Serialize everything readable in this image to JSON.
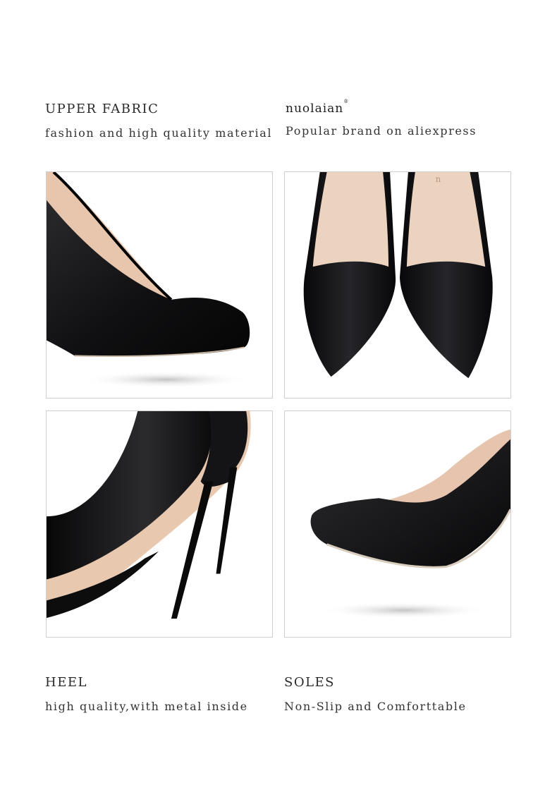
{
  "features": {
    "upper": {
      "title": "UPPER FABRIC",
      "subtitle": "fashion and high quality material"
    },
    "brand": {
      "logo": "nuolaian",
      "trademark": "®",
      "subtitle": "Popular brand on aliexpress"
    },
    "heel": {
      "title": "HEEL",
      "subtitle": "high quality,with metal inside"
    },
    "soles": {
      "title": "SOLES",
      "subtitle": "Non-Slip and Comforttable"
    }
  },
  "colors": {
    "leather": "#0f0f10",
    "lining": "#e9c9b2",
    "panel_border": "#cfcfcf"
  }
}
